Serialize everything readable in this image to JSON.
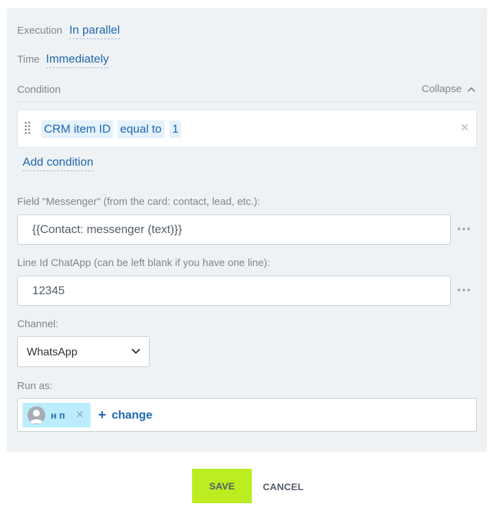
{
  "execution": {
    "label": "Execution",
    "value": "In parallel"
  },
  "time": {
    "label": "Time",
    "value": "Immediately"
  },
  "condition": {
    "label": "Condition",
    "collapse_label": "Collapse",
    "field": "CRM item ID",
    "operator": "equal to",
    "value": "1",
    "add_label": "Add condition"
  },
  "messenger_field": {
    "label": "Field \"Messenger\" (from the card: contact, lead, etc.):",
    "value": "{{Contact: messenger (text)}}"
  },
  "line_id_field": {
    "label": "Line Id ChatApp (can be left blank if you have one line):",
    "value": "12345"
  },
  "channel": {
    "label": "Channel:",
    "selected": "WhatsApp"
  },
  "run_as": {
    "label": "Run as:",
    "user_name": "н п",
    "change_label": "change",
    "change_icon": "plus-icon"
  },
  "actions": {
    "save_label": "SAVE",
    "cancel_label": "CANCEL"
  },
  "colors": {
    "accent": "#2067b0",
    "save_button": "#bbed21",
    "user_chip": "#bcedfc",
    "panel": "#eef2f4"
  }
}
